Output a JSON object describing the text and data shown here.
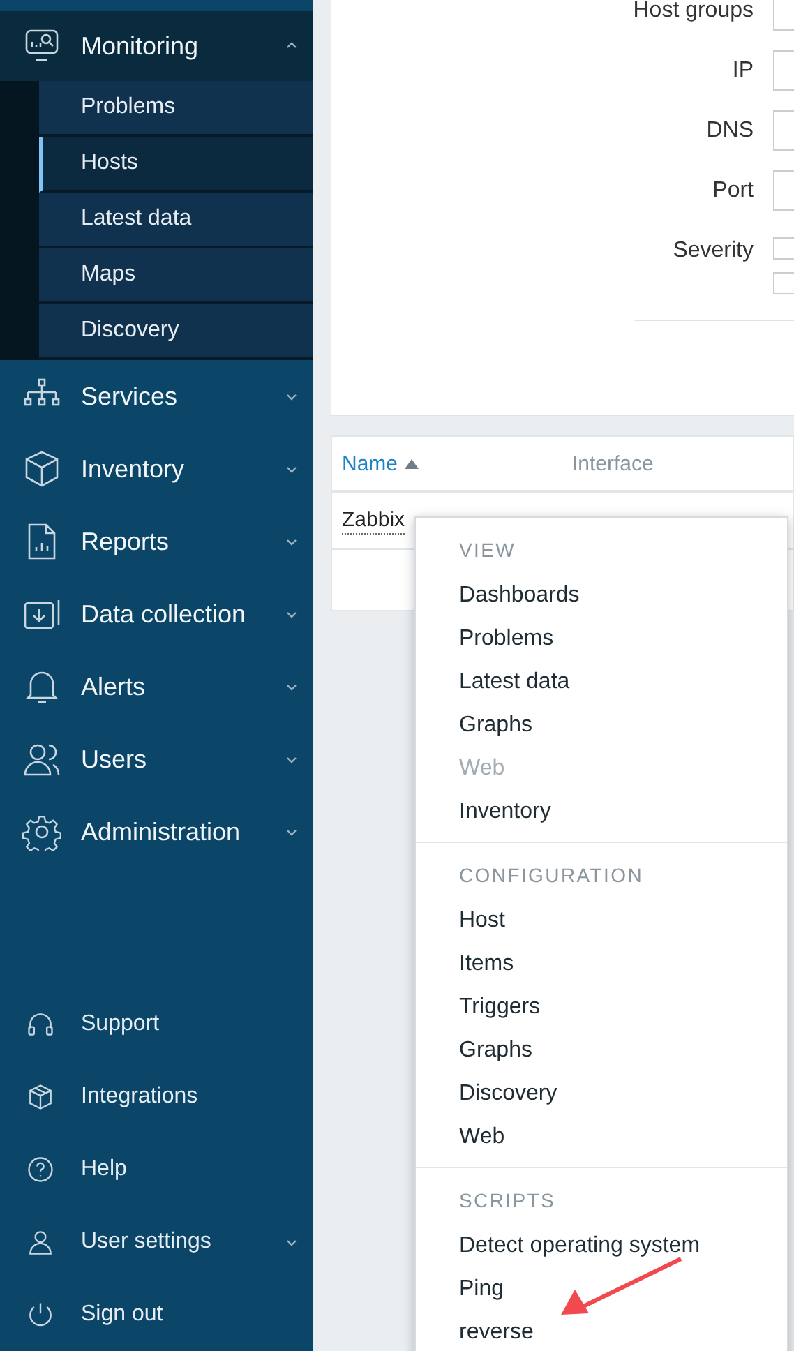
{
  "sidebar": {
    "nav": [
      {
        "label": "Monitoring",
        "expanded": true,
        "children": [
          {
            "label": "Problems",
            "selected": false
          },
          {
            "label": "Hosts",
            "selected": true
          },
          {
            "label": "Latest data",
            "selected": false
          },
          {
            "label": "Maps",
            "selected": false
          },
          {
            "label": "Discovery",
            "selected": false
          }
        ]
      },
      {
        "label": "Services",
        "expanded": false
      },
      {
        "label": "Inventory",
        "expanded": false
      },
      {
        "label": "Reports",
        "expanded": false
      },
      {
        "label": "Data collection",
        "expanded": false
      },
      {
        "label": "Alerts",
        "expanded": false
      },
      {
        "label": "Users",
        "expanded": false
      },
      {
        "label": "Administration",
        "expanded": false
      }
    ],
    "footer": [
      {
        "label": "Support",
        "kind": "link"
      },
      {
        "label": "Integrations",
        "kind": "link"
      },
      {
        "label": "Help",
        "kind": "link"
      },
      {
        "label": "User settings",
        "kind": "menu"
      },
      {
        "label": "Sign out",
        "kind": "link"
      }
    ]
  },
  "filter": {
    "fields": [
      {
        "label": "Host groups",
        "kind": "input"
      },
      {
        "label": "IP",
        "kind": "input"
      },
      {
        "label": "DNS",
        "kind": "input"
      },
      {
        "label": "Port",
        "kind": "input"
      },
      {
        "label": "Severity",
        "kind": "checkboxes",
        "options": [
          {
            "checked": false
          },
          {
            "checked": false
          }
        ]
      }
    ]
  },
  "table": {
    "columns": [
      {
        "label": "Name",
        "sorted": true
      },
      {
        "label": "Interface",
        "sorted": false
      }
    ],
    "rows": [
      {
        "name": "Zabbix"
      }
    ]
  },
  "context_menu": {
    "sections": [
      {
        "title": "VIEW",
        "items": [
          {
            "label": "Dashboards",
            "disabled": false
          },
          {
            "label": "Problems",
            "disabled": false
          },
          {
            "label": "Latest data",
            "disabled": false
          },
          {
            "label": "Graphs",
            "disabled": false
          },
          {
            "label": "Web",
            "disabled": true
          },
          {
            "label": "Inventory",
            "disabled": false
          }
        ]
      },
      {
        "title": "CONFIGURATION",
        "items": [
          {
            "label": "Host",
            "disabled": false
          },
          {
            "label": "Items",
            "disabled": false
          },
          {
            "label": "Triggers",
            "disabled": false
          },
          {
            "label": "Graphs",
            "disabled": false
          },
          {
            "label": "Discovery",
            "disabled": false
          },
          {
            "label": "Web",
            "disabled": false
          }
        ]
      },
      {
        "title": "SCRIPTS",
        "items": [
          {
            "label": "Detect operating system",
            "disabled": false
          },
          {
            "label": "Ping",
            "disabled": false
          },
          {
            "label": "reverse",
            "disabled": false
          }
        ]
      }
    ]
  }
}
